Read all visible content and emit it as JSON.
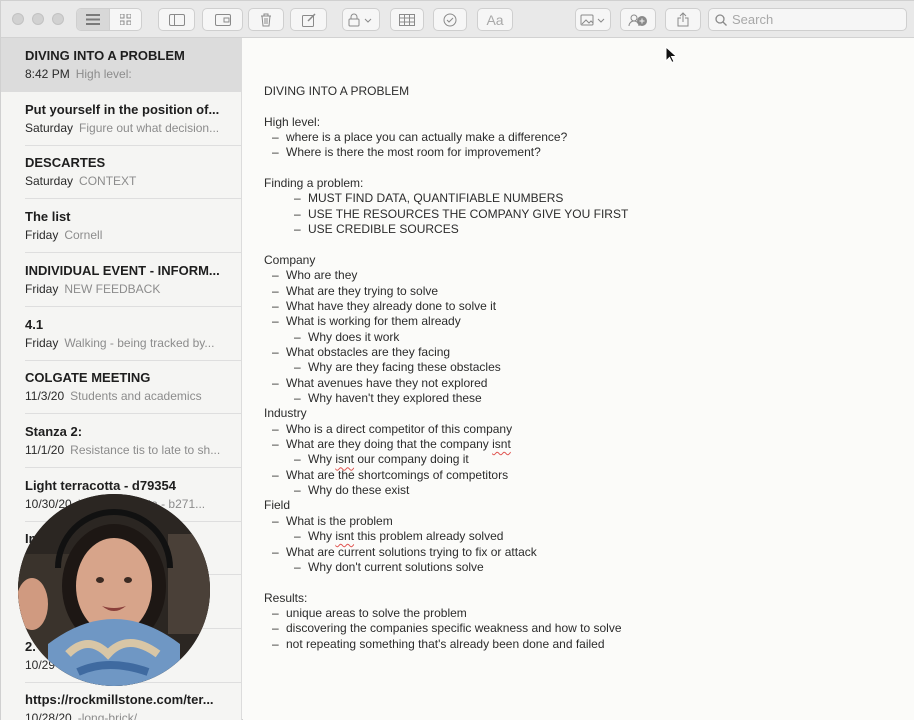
{
  "toolbar": {
    "search_placeholder": "Search",
    "font_label": "Aa"
  },
  "sidebar": {
    "notes": [
      {
        "title": "DIVING INTO A PROBLEM",
        "date": "8:42 PM",
        "preview": "High level:",
        "selected": true
      },
      {
        "title": "Put yourself in the position of...",
        "date": "Saturday",
        "preview": "Figure out what decision..."
      },
      {
        "title": "DESCARTES",
        "date": "Saturday",
        "preview": "CONTEXT"
      },
      {
        "title": "The list",
        "date": "Friday",
        "preview": "Cornell"
      },
      {
        "title": "INDIVIDUAL EVENT - INFORM...",
        "date": "Friday",
        "preview": "NEW FEEDBACK"
      },
      {
        "title": "4.1",
        "date": "Friday",
        "preview": "Walking - being tracked by..."
      },
      {
        "title": "COLGATE MEETING",
        "date": "11/3/20",
        "preview": "Students and academics"
      },
      {
        "title": "Stanza 2:",
        "date": "11/1/20",
        "preview": "Resistance tis to late to sh..."
      },
      {
        "title": "Light terracotta - d79354",
        "date": "10/30/20",
        "preview": "Light terracotta - b271..."
      },
      {
        "title": "Im...ve...",
        "date": "",
        "preview": ""
      },
      {
        "title": "",
        "date": "",
        "preview": ""
      },
      {
        "title": "2.",
        "date": "10/29",
        "preview": ""
      },
      {
        "title": "https://rockmillstone.com/ter...",
        "date": "10/28/20",
        "preview": "-long-brick/"
      }
    ]
  },
  "editor": {
    "lines": [
      {
        "text": "DIVING INTO A PROBLEM",
        "level": 0
      },
      {
        "text": "",
        "level": 0
      },
      {
        "text": "High level:",
        "level": 0
      },
      {
        "text": "where is a place you can actually make a difference?",
        "level": 1
      },
      {
        "text": "Where is there the most room for improvement?",
        "level": 1
      },
      {
        "text": "",
        "level": 0
      },
      {
        "text": "Finding a problem:",
        "level": 0
      },
      {
        "text": "MUST FIND DATA, QUANTIFIABLE NUMBERS",
        "level": 2
      },
      {
        "text": "USE THE RESOURCES THE COMPANY GIVE YOU FIRST",
        "level": 2
      },
      {
        "text": "USE CREDIBLE SOURCES",
        "level": 2
      },
      {
        "text": "",
        "level": 0
      },
      {
        "text": "Company",
        "level": 0
      },
      {
        "text": "Who are they",
        "level": 1
      },
      {
        "text": "What are they trying to solve",
        "level": 1
      },
      {
        "text": "What have they already done to solve it",
        "level": 1
      },
      {
        "text": "What is working for them already",
        "level": 1
      },
      {
        "text": "Why does it work",
        "level": 2
      },
      {
        "text": "What obstacles are they facing",
        "level": 1
      },
      {
        "text": "Why are they facing these obstacles",
        "level": 2
      },
      {
        "text": "What avenues have they not explored",
        "level": 1
      },
      {
        "text": "Why haven't they explored these",
        "level": 2
      },
      {
        "text": "Industry",
        "level": 0
      },
      {
        "text": "Who is a direct competitor of this company",
        "level": 1
      },
      {
        "text": "What are they doing that the company isnt",
        "level": 1,
        "misspelled": "isnt"
      },
      {
        "text": "Why isnt our company doing it",
        "level": 2,
        "misspelled": "isnt"
      },
      {
        "text": "What are the shortcomings of competitors",
        "level": 1
      },
      {
        "text": "Why do these exist",
        "level": 2
      },
      {
        "text": "Field",
        "level": 0
      },
      {
        "text": "What is the problem",
        "level": 1
      },
      {
        "text": "Why isnt this problem already solved",
        "level": 2,
        "misspelled": "isnt"
      },
      {
        "text": "What are current solutions trying to fix or attack",
        "level": 1
      },
      {
        "text": "Why don't current solutions solve",
        "level": 2
      },
      {
        "text": "",
        "level": 0
      },
      {
        "text": "Results:",
        "level": 0
      },
      {
        "text": "unique areas to solve the problem",
        "level": 1
      },
      {
        "text": "discovering the companies specific weakness and how to solve",
        "level": 1
      },
      {
        "text": "not repeating something that's already been done and failed",
        "level": 1
      }
    ]
  }
}
